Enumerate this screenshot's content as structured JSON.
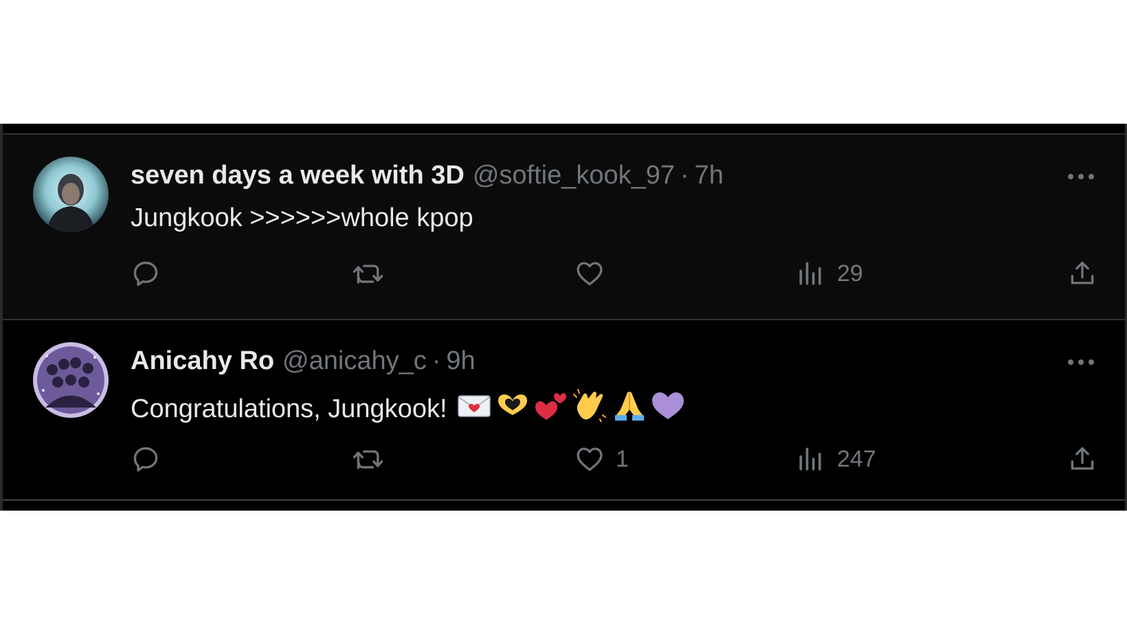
{
  "tweets": [
    {
      "display_name": "seven days a week with 3D",
      "handle": "@softie_kook_97",
      "separator": "·",
      "time": "7h",
      "text": "Jungkook >>>>>>whole kpop",
      "emojis": [],
      "counts": {
        "replies": "",
        "retweets": "",
        "likes": "",
        "views": "29"
      }
    },
    {
      "display_name": "Anicahy Ro",
      "handle": "@anicahy_c",
      "separator": "·",
      "time": "9h",
      "text": "Congratulations, Jungkook!",
      "emojis": [
        "love-letter-emoji",
        "heart-hands-emoji",
        "two-hearts-emoji",
        "clapping-hands-emoji",
        "folded-hands-emoji",
        "purple-heart-emoji"
      ],
      "counts": {
        "replies": "",
        "retweets": "",
        "likes": "1",
        "views": "247"
      }
    }
  ],
  "colors": {
    "background": "#000000",
    "card": "#0b0b0b",
    "text": "#e7e9ea",
    "muted": "#71767b",
    "divider": "#2f3336"
  }
}
